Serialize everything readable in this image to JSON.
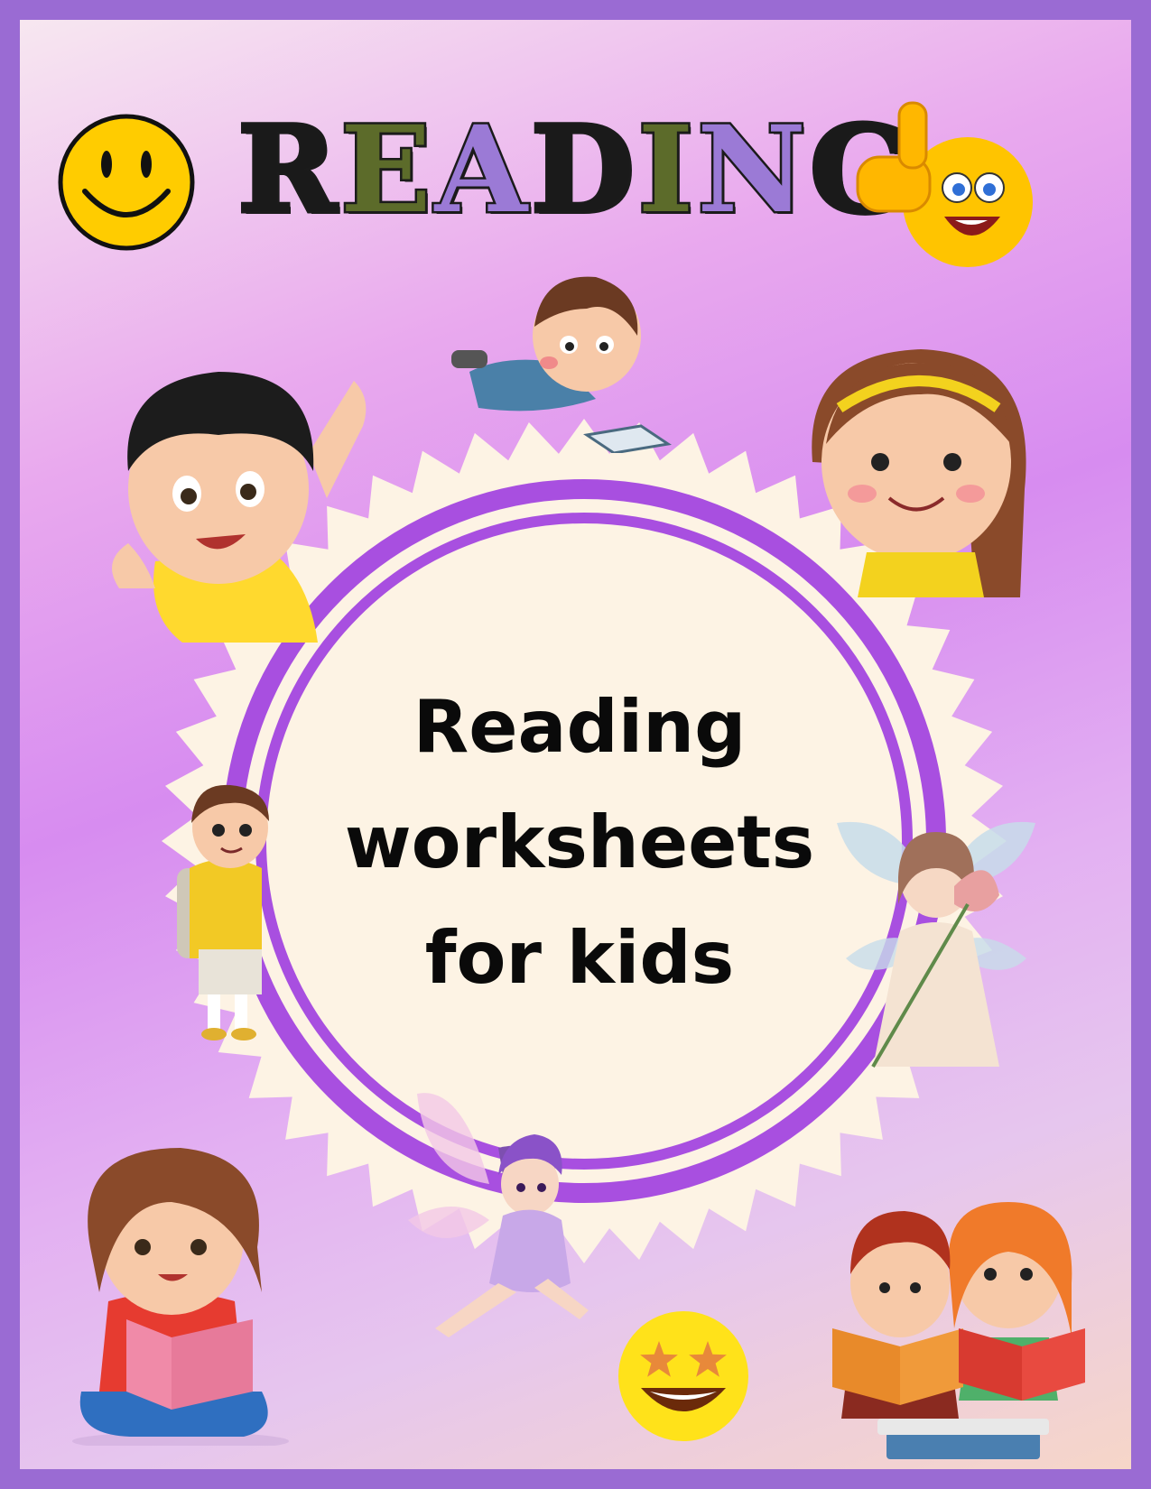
{
  "cover": {
    "title_letters": [
      "R",
      "E",
      "A",
      "D",
      "I",
      "N",
      "G"
    ],
    "subtitle_lines": [
      "Reading",
      "worksheets",
      "for kids"
    ]
  },
  "colors": {
    "border": "#9a6bd3",
    "ring": "#a84fe0",
    "burst": "#fdf3e4",
    "title_letters": [
      "#1a1a1a",
      "#5c6b2a",
      "#9b7ad6",
      "#1a1a1a",
      "#5c6b2a",
      "#9b7ad6",
      "#1a1a1a"
    ]
  },
  "icons": [
    "smiley-face-icon",
    "thumbs-up-emoji-icon",
    "star-eyes-emoji-icon"
  ],
  "illustrations": [
    "boy-waving",
    "boy-lying-reading",
    "girl-headband",
    "boy-backpack",
    "fairy-flower",
    "fairy-purple",
    "girl-reading",
    "kids-reading-books"
  ]
}
